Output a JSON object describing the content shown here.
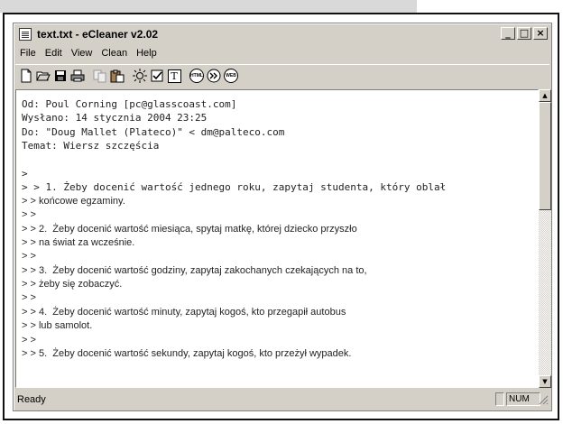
{
  "window": {
    "title": "text.txt - eCleaner v2.02",
    "controls": {
      "minimize": "_",
      "maximize": "□",
      "close": "×"
    }
  },
  "menu": [
    "File",
    "Edit",
    "View",
    "Clean",
    "Help"
  ],
  "toolbar": {
    "icons": [
      "new-file-icon",
      "open-folder-icon",
      "save-icon",
      "print-icon",
      "copy-icon",
      "paste-icon",
      "settings-sun-icon",
      "checkbox-icon",
      "text-icon",
      "html-icon",
      "forward-icon",
      "web-icon"
    ],
    "text_button_label": "T",
    "html_label": "HTML",
    "web_label": "WEB"
  },
  "editor": {
    "lines": [
      {
        "text": "Od: Poul Corning [pc@glasscoast.com]",
        "font": "mono"
      },
      {
        "text": "Wysłano: 14 stycznia 2004 23:25",
        "font": "mono"
      },
      {
        "text": "Do: \"Doug Mallet (Plateco)\" < dm@palteco.com",
        "font": "mono"
      },
      {
        "text": "Temat: Wiersz szczęścia",
        "font": "mono"
      },
      {
        "text": "",
        "font": "mono"
      },
      {
        "text": ">",
        "font": "mono"
      },
      {
        "text": "> > 1. Żeby docenić wartość jednego roku, zapytaj studenta, który oblał",
        "font": "mono"
      },
      {
        "text": "> > końcowe egzaminy.",
        "font": "sans"
      },
      {
        "text": "> >",
        "font": "sans"
      },
      {
        "text": "> > 2.  Żeby docenić wartość miesiąca, spytaj matkę, której dziecko przyszło",
        "font": "sans"
      },
      {
        "text": "> > na świat za wcześnie.",
        "font": "sans"
      },
      {
        "text": "> >",
        "font": "sans"
      },
      {
        "text": "> > 3.  Żeby docenić wartość godziny, zapytaj zakochanych czekających na to,",
        "font": "sans"
      },
      {
        "text": "> > żeby się zobaczyć.",
        "font": "sans"
      },
      {
        "text": "> >",
        "font": "sans"
      },
      {
        "text": "> > 4.  Żeby docenić wartość minuty, zapytaj kogoś, kto przegapił autobus",
        "font": "sans"
      },
      {
        "text": "> > lub samolot.",
        "font": "sans"
      },
      {
        "text": "> >",
        "font": "sans"
      },
      {
        "text": "> > 5.  Żeby docenić wartość sekundy, zapytaj kogoś, kto przeżył wypadek.",
        "font": "sans"
      }
    ]
  },
  "scrollbar": {
    "up": "▲",
    "down": "▼"
  },
  "statusbar": {
    "status": "Ready",
    "num": "NUM"
  }
}
